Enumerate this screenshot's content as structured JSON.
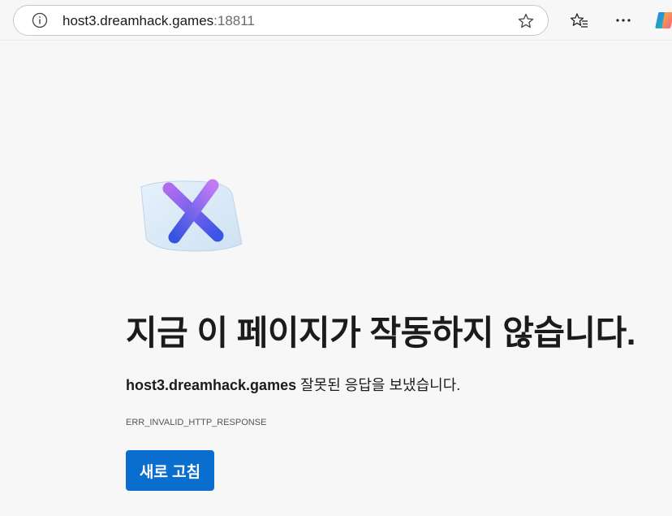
{
  "browser": {
    "url_host": "host3.dreamhack.games",
    "url_port": ":18811",
    "icons": {
      "info": "info-icon",
      "favorite": "star-icon",
      "favorites_list": "favorites-icon",
      "more": "more-icon",
      "copilot": "copilot-icon"
    }
  },
  "error": {
    "title": "지금 이 페이지가 작동하지 않습니다.",
    "host": "host3.dreamhack.games",
    "message_suffix": " 잘못된 응답을 보냈습니다.",
    "code": "ERR_INVALID_HTTP_RESPONSE",
    "reload_label": "새로 고침"
  },
  "colors": {
    "page_background": "#f7f7f7",
    "button_background": "#0a6ecf",
    "button_text": "#ffffff",
    "title_text": "#1b1b1b"
  }
}
